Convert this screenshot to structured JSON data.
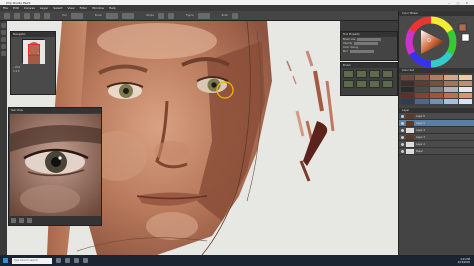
{
  "window": {
    "title": "Clip Studio Paint"
  },
  "menu": {
    "items": [
      "File",
      "Edit",
      "Canvas",
      "Layer",
      "Select",
      "View",
      "Filter",
      "Window",
      "Help"
    ]
  },
  "toolbar": {
    "sections": [
      "Tool",
      "Brush",
      "Shape",
      "Figure",
      "Ruler"
    ]
  },
  "navigator": {
    "title": "Navigator",
    "zoom": "25.0",
    "angle": "0.0"
  },
  "subview": {
    "title": "Sub View"
  },
  "tool_property": {
    "tab": "Tool Property",
    "rows": [
      "Brush size",
      "Opacity",
      "Color mixing",
      "Blur"
    ]
  },
  "brush_panel": {
    "title": "Brush"
  },
  "color_panel": {
    "title": "Color Wheel"
  },
  "swatch_panel": {
    "title": "Color Set",
    "colors": [
      "#6e4a3a",
      "#8c5a44",
      "#b87a5f",
      "#d9a587",
      "#f0c8aa",
      "#3d2c2a",
      "#5a3e34",
      "#7a4f3d",
      "#a8735a",
      "#c48d6f",
      "#2b2b2b",
      "#4a4a4a",
      "#7d7d7d",
      "#b5b5b5",
      "#e8e8e8",
      "#5c2f2a",
      "#8a3f35",
      "#a94f3e",
      "#c56b52",
      "#e09079",
      "#2d3e52",
      "#4b6a8a",
      "#6f93b5",
      "#a3c2de",
      "#d6e6f2"
    ]
  },
  "layers": {
    "title": "Layer",
    "items": [
      {
        "name": "Layer 6",
        "selected": false,
        "dark": true
      },
      {
        "name": "Layer 5",
        "selected": true,
        "dark": true
      },
      {
        "name": "Layer 4",
        "selected": false,
        "dark": false
      },
      {
        "name": "Layer 3",
        "selected": false,
        "dark": true
      },
      {
        "name": "Layer 2",
        "selected": false,
        "dark": false
      },
      {
        "name": "Paper",
        "selected": false,
        "dark": false
      }
    ]
  },
  "taskbar": {
    "search_placeholder": "Type here to search",
    "time": "4:21 PM",
    "date": "2/19/2020"
  }
}
